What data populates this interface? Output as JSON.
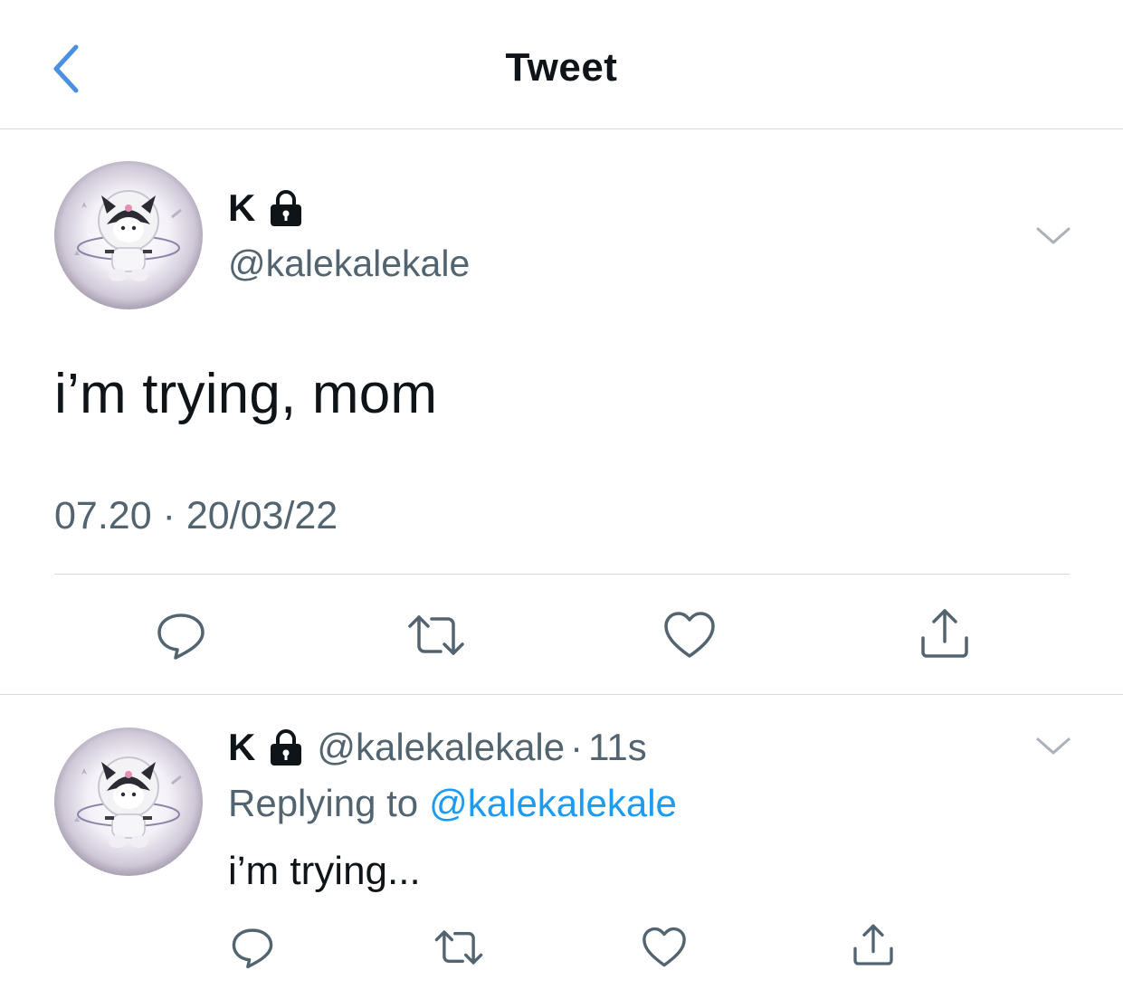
{
  "header": {
    "title": "Tweet"
  },
  "tweet": {
    "name": "K",
    "handle": "@kalekalekale",
    "text": "i’m trying, mom",
    "time": "07.20",
    "separator": "·",
    "date": "20/03/22"
  },
  "reply": {
    "name": "K",
    "handle": "@kalekalekale",
    "separator": "·",
    "age": "11s",
    "replying_label": "Replying to",
    "replying_to": "@kalekalekale",
    "text": "i’m trying..."
  },
  "colors": {
    "accent": "#1d9bf0",
    "text_primary": "#0f1419",
    "text_secondary": "#536471",
    "icon": "#536471",
    "divider": "#d7dadd"
  },
  "icons": {
    "back": "chevron-left-icon",
    "lock": "lock-icon",
    "more": "chevron-down-icon",
    "reply": "reply-bubble-icon",
    "retweet": "retweet-icon",
    "like": "heart-icon",
    "share": "share-icon"
  }
}
